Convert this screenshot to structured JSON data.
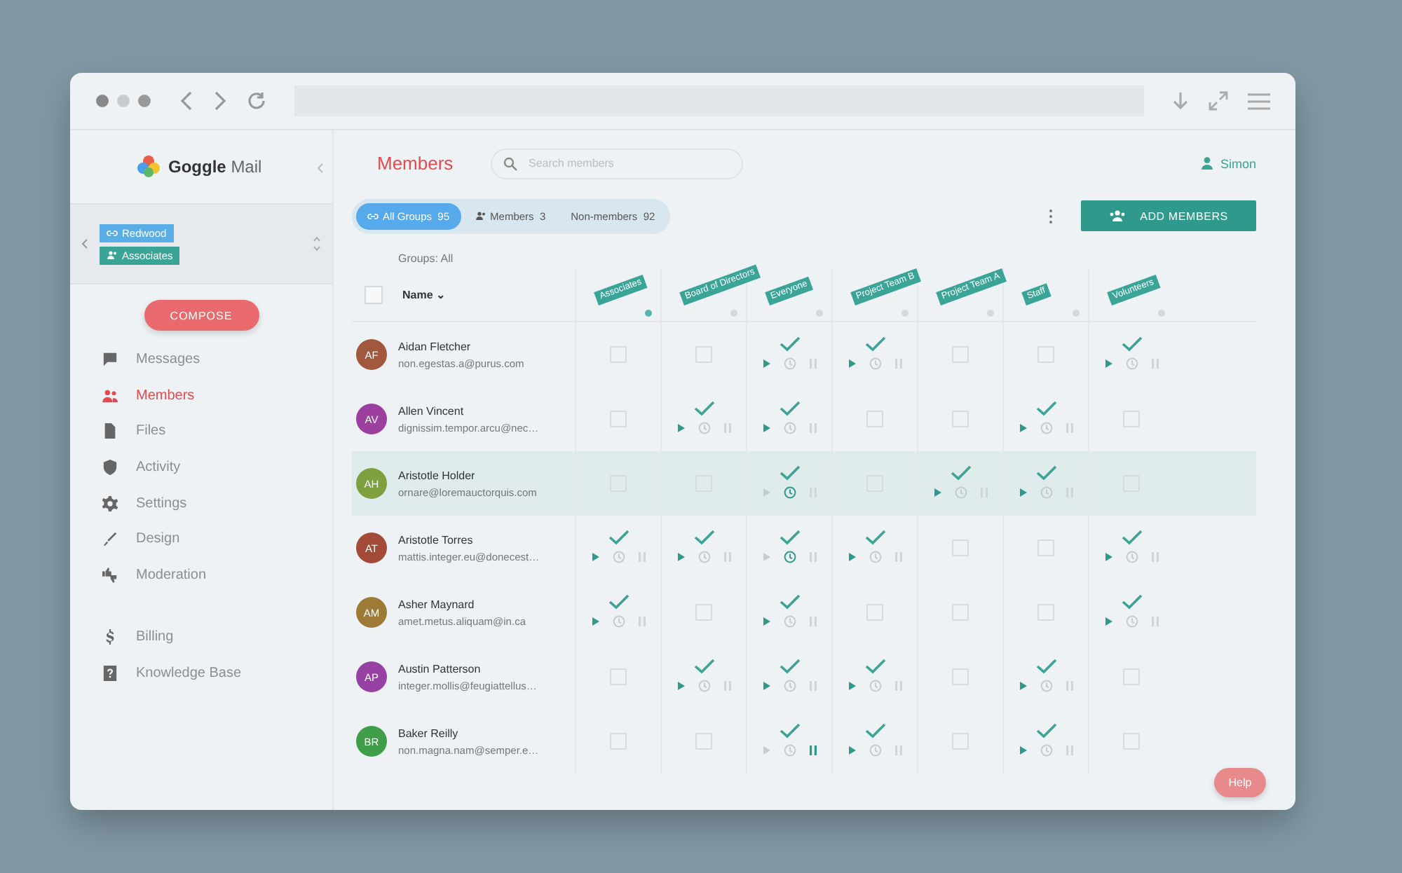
{
  "app": {
    "logo_word_bold": "Goggle",
    "logo_word_light": "Mail"
  },
  "account": {
    "tags": [
      {
        "kind": "link",
        "label": "Redwood",
        "color": "#5aaee8"
      },
      {
        "kind": "people",
        "label": "Associates",
        "color": "#3aa597"
      }
    ]
  },
  "compose_button": "COMPOSE",
  "nav": [
    {
      "label": "Messages",
      "selected": false
    },
    {
      "label": "Members",
      "selected": true
    },
    {
      "label": "Files",
      "selected": false
    },
    {
      "label": "Activity",
      "selected": false
    },
    {
      "label": "Settings",
      "selected": false
    },
    {
      "label": "Design",
      "selected": false
    },
    {
      "label": "Moderation",
      "selected": false
    }
  ],
  "nav_secondary": [
    {
      "label": "Billing",
      "selected": false
    },
    {
      "label": "Knowledge Base",
      "selected": false
    }
  ],
  "page_title": "Members",
  "search": {
    "placeholder": "Search members"
  },
  "user": "Simon",
  "filters": [
    {
      "label": "All Groups",
      "count": "95",
      "selected": true
    },
    {
      "label": "Members",
      "count": "3",
      "selected": false
    },
    {
      "label": "Non-members",
      "count": "92",
      "selected": false
    }
  ],
  "add_button": "ADD MEMBERS",
  "groups_caption": "Groups: All",
  "select_all": {
    "checked": false
  },
  "name_column": "Name",
  "sort_caret": "⌄",
  "columns": [
    {
      "label": "Associates",
      "selected": true
    },
    {
      "label": "Board of Directors",
      "selected": false
    },
    {
      "label": "Everyone",
      "selected": false
    },
    {
      "label": "Project Team B",
      "selected": false
    },
    {
      "label": "Project Team A",
      "selected": false
    },
    {
      "label": "Staff",
      "selected": false
    },
    {
      "label": "Volunteers",
      "selected": false
    }
  ],
  "rows": [
    {
      "initials": "AF",
      "name": "Aidan Fletcher",
      "email": "non.egestas.a@purus.com",
      "color": "#a0593f",
      "selected": false,
      "cells": [
        {
          "checked": false
        },
        {
          "checked": false
        },
        {
          "checked": true,
          "playing": true,
          "scheduled": false,
          "paused": false
        },
        {
          "checked": true,
          "playing": true,
          "scheduled": false,
          "paused": false
        },
        {
          "checked": false
        },
        {
          "checked": false
        },
        {
          "checked": true,
          "playing": true,
          "scheduled": false,
          "paused": false
        }
      ]
    },
    {
      "initials": "AV",
      "name": "Allen Vincent",
      "email": "dignissim.tempor.arcu@nec…",
      "color": "#9c3f9e",
      "selected": false,
      "cells": [
        {
          "checked": false
        },
        {
          "checked": true,
          "playing": true,
          "scheduled": false,
          "paused": false
        },
        {
          "checked": true,
          "playing": true,
          "scheduled": false,
          "paused": false
        },
        {
          "checked": false
        },
        {
          "checked": false
        },
        {
          "checked": true,
          "playing": true,
          "scheduled": false,
          "paused": false
        },
        {
          "checked": false
        }
      ]
    },
    {
      "initials": "AH",
      "name": "Aristotle Holder",
      "email": "ornare@loremauctorquis.com",
      "color": "#7ea03f",
      "selected": true,
      "cells": [
        {
          "checked": false
        },
        {
          "checked": false
        },
        {
          "checked": true,
          "playing": false,
          "scheduled": true,
          "paused": false
        },
        {
          "checked": false
        },
        {
          "checked": true,
          "playing": true,
          "scheduled": false,
          "paused": false
        },
        {
          "checked": true,
          "playing": true,
          "scheduled": false,
          "paused": false
        },
        {
          "checked": false
        }
      ]
    },
    {
      "initials": "AT",
      "name": "Aristotle Torres",
      "email": "mattis.integer.eu@donecest…",
      "color": "#a34a38",
      "selected": false,
      "cells": [
        {
          "checked": true,
          "playing": true,
          "scheduled": false,
          "paused": false
        },
        {
          "checked": true,
          "playing": true,
          "scheduled": false,
          "paused": false
        },
        {
          "checked": true,
          "playing": false,
          "scheduled": true,
          "paused": false
        },
        {
          "checked": true,
          "playing": true,
          "scheduled": false,
          "paused": false
        },
        {
          "checked": false
        },
        {
          "checked": false
        },
        {
          "checked": true,
          "playing": true,
          "scheduled": false,
          "paused": false
        }
      ]
    },
    {
      "initials": "AM",
      "name": "Asher Maynard",
      "email": "amet.metus.aliquam@in.ca",
      "color": "#9d7a35",
      "selected": false,
      "cells": [
        {
          "checked": true,
          "playing": true,
          "scheduled": false,
          "paused": false
        },
        {
          "checked": false
        },
        {
          "checked": true,
          "playing": true,
          "scheduled": false,
          "paused": false
        },
        {
          "checked": false
        },
        {
          "checked": false
        },
        {
          "checked": false
        },
        {
          "checked": true,
          "playing": true,
          "scheduled": false,
          "paused": false
        }
      ]
    },
    {
      "initials": "AP",
      "name": "Austin Patterson",
      "email": "integer.mollis@feugiattellus…",
      "color": "#9641a3",
      "selected": false,
      "cells": [
        {
          "checked": false
        },
        {
          "checked": true,
          "playing": true,
          "scheduled": false,
          "paused": false
        },
        {
          "checked": true,
          "playing": true,
          "scheduled": false,
          "paused": false
        },
        {
          "checked": true,
          "playing": true,
          "scheduled": false,
          "paused": false
        },
        {
          "checked": false
        },
        {
          "checked": true,
          "playing": true,
          "scheduled": false,
          "paused": false
        },
        {
          "checked": false
        }
      ]
    },
    {
      "initials": "BR",
      "name": "Baker Reilly",
      "email": "non.magna.nam@semper.e…",
      "color": "#3f9e48",
      "selected": false,
      "cells": [
        {
          "checked": false
        },
        {
          "checked": false
        },
        {
          "checked": true,
          "playing": false,
          "scheduled": false,
          "paused": true
        },
        {
          "checked": true,
          "playing": true,
          "scheduled": false,
          "paused": false
        },
        {
          "checked": false
        },
        {
          "checked": true,
          "playing": true,
          "scheduled": false,
          "paused": false
        },
        {
          "checked": false
        }
      ]
    }
  ],
  "help_button": "Help"
}
